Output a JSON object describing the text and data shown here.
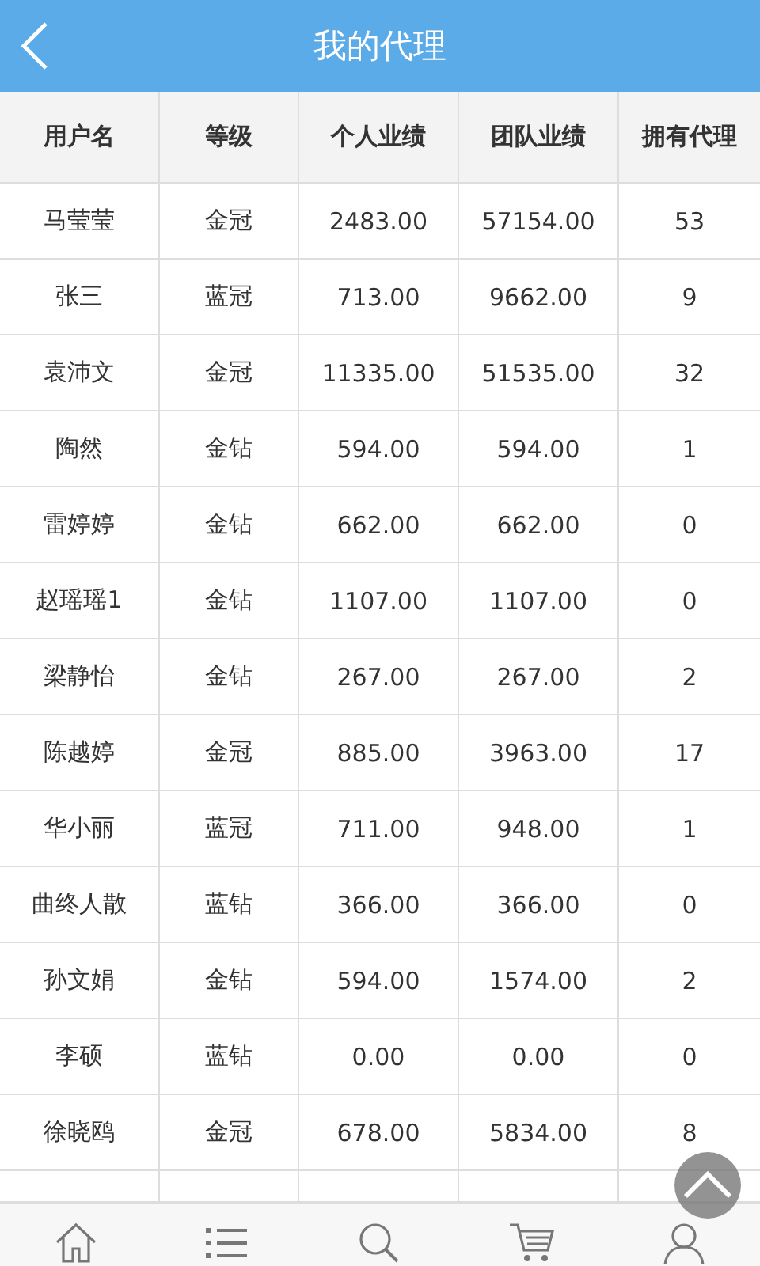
{
  "header": {
    "title": "我的代理"
  },
  "table": {
    "columns": [
      "用户名",
      "等级",
      "个人业绩",
      "团队业绩",
      "拥有代理"
    ],
    "rows": [
      [
        "马莹莹",
        "金冠",
        "2483.00",
        "57154.00",
        "53"
      ],
      [
        "张三",
        "蓝冠",
        "713.00",
        "9662.00",
        "9"
      ],
      [
        "袁沛文",
        "金冠",
        "11335.00",
        "51535.00",
        "32"
      ],
      [
        "陶然",
        "金钻",
        "594.00",
        "594.00",
        "1"
      ],
      [
        "雷婷婷",
        "金钻",
        "662.00",
        "662.00",
        "0"
      ],
      [
        "赵瑶瑶1",
        "金钻",
        "1107.00",
        "1107.00",
        "0"
      ],
      [
        "梁静怡",
        "金钻",
        "267.00",
        "267.00",
        "2"
      ],
      [
        "陈越婷",
        "金冠",
        "885.00",
        "3963.00",
        "17"
      ],
      [
        "华小丽",
        "蓝冠",
        "711.00",
        "948.00",
        "1"
      ],
      [
        "曲终人散",
        "蓝钻",
        "366.00",
        "366.00",
        "0"
      ],
      [
        "孙文娟",
        "金钻",
        "594.00",
        "1574.00",
        "2"
      ],
      [
        "李硕",
        "蓝钻",
        "0.00",
        "0.00",
        "0"
      ],
      [
        "徐晓鸥",
        "金冠",
        "678.00",
        "5834.00",
        "8"
      ]
    ]
  },
  "nav": [
    {
      "kind": "home"
    },
    {
      "kind": "list"
    },
    {
      "kind": "search"
    },
    {
      "kind": "cart"
    },
    {
      "kind": "user"
    }
  ]
}
